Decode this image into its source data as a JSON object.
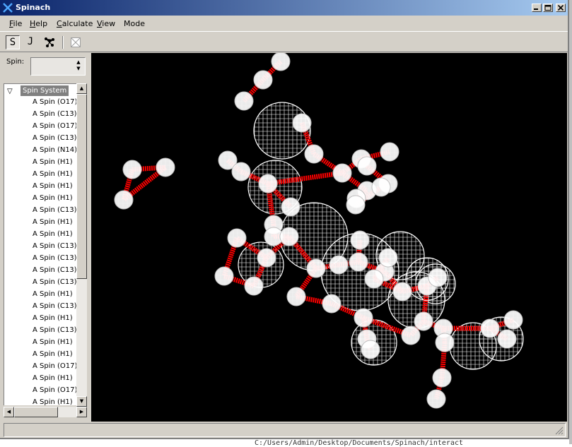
{
  "window": {
    "title": "Spinach"
  },
  "menu": {
    "items": [
      {
        "label": "File",
        "mnemonic": "F",
        "rest": "ile"
      },
      {
        "label": "Help",
        "mnemonic": "H",
        "rest": "elp"
      },
      {
        "label": "Calculate",
        "mnemonic": "C",
        "rest": "alculate"
      },
      {
        "label": "View",
        "mnemonic": "V",
        "rest": "iew"
      },
      {
        "label": "Mode",
        "mnemonic": "",
        "rest": "Mode"
      }
    ]
  },
  "toolbar": {
    "s_label": "S",
    "j_label": "J"
  },
  "spin_selector": {
    "label": "Spin:",
    "value": ""
  },
  "tree": {
    "root_label": "Spin System",
    "items": [
      "A Spin (O17)",
      "A Spin (C13)",
      "A Spin (O17)",
      "A Spin (C13)",
      "A Spin (N14)",
      "A Spin (H1)",
      "A Spin (H1)",
      "A Spin (H1)",
      "A Spin (H1)",
      "A Spin (C13)",
      "A Spin (H1)",
      "A Spin (H1)",
      "A Spin (C13)",
      "A Spin (C13)",
      "A Spin (C13)",
      "A Spin (C13)",
      "A Spin (H1)",
      "A Spin (C13)",
      "A Spin (H1)",
      "A Spin (C13)",
      "A Spin (H1)",
      "A Spin (H1)",
      "A Spin (O17)",
      "A Spin (H1)",
      "A Spin (O17)",
      "A Spin (H1)"
    ]
  },
  "colors": {
    "bond": "#ff0000",
    "atom": "#ffffff",
    "background": "#000000"
  },
  "background_text": "C:/Users/Admin/Desktop/Documents/Spinach/interact"
}
